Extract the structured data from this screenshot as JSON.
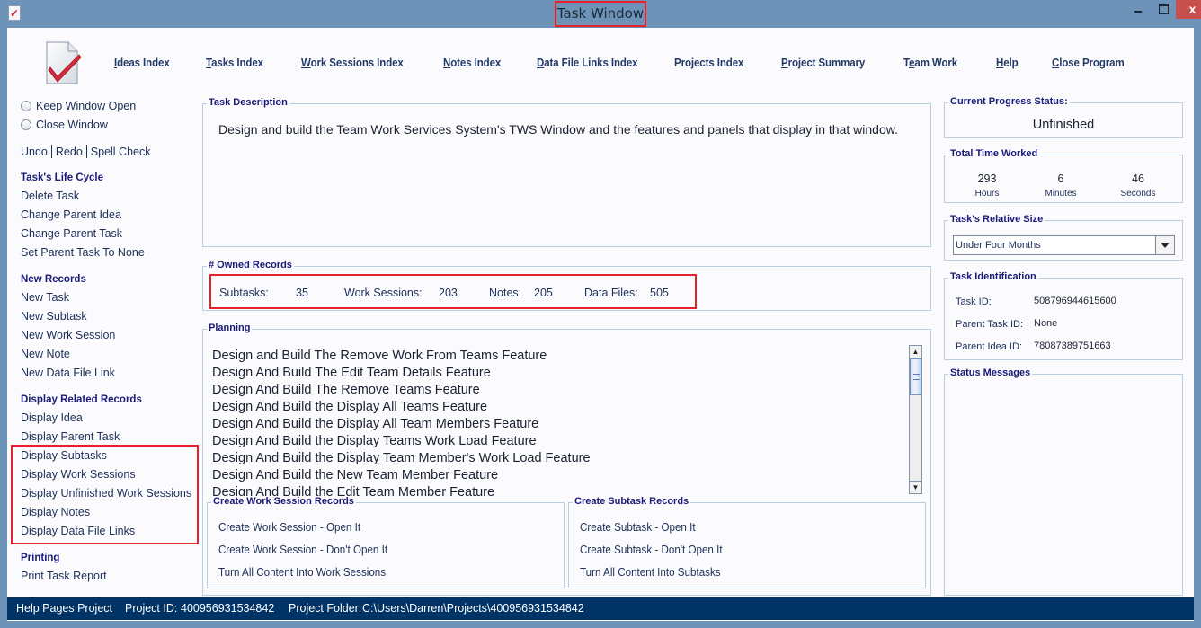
{
  "window": {
    "title": "Task Window",
    "close_glyph": "x"
  },
  "nav": [
    {
      "label": "Ideas Index",
      "mnemonic": "I"
    },
    {
      "label": "Tasks Index",
      "mnemonic": "T"
    },
    {
      "label": "Work Sessions Index",
      "mnemonic": "W"
    },
    {
      "label": "Notes Index",
      "mnemonic": "N"
    },
    {
      "label": "Data File Links Index",
      "mnemonic": "D"
    },
    {
      "label": "Projects Index",
      "mnemonic": ""
    },
    {
      "label": "Project Summary",
      "mnemonic": "P"
    },
    {
      "label": "Team Work",
      "mnemonic": "e"
    },
    {
      "label": "Help",
      "mnemonic": "H"
    },
    {
      "label": "Close Program",
      "mnemonic": "C"
    }
  ],
  "sidebar": {
    "radio_keep": "Keep Window Open",
    "radio_close": "Close Window",
    "undo": "Undo",
    "redo": "Redo",
    "spell_check": "Spell Check",
    "life_cycle": {
      "heading": "Task's Life Cycle",
      "items": [
        "Delete Task",
        "Change Parent Idea",
        "Change Parent Task",
        "Set Parent Task To None"
      ]
    },
    "new_records": {
      "heading": "New Records",
      "items": [
        "New Task",
        "New Subtask",
        "New Work Session",
        "New Note",
        "New Data File Link"
      ]
    },
    "display_related": {
      "heading": "Display Related Records",
      "items": [
        "Display Idea",
        "Display Parent Task",
        "Display Subtasks",
        "Display Work Sessions",
        "Display Unfinished Work Sessions",
        "Display Notes",
        "Display Data File Links"
      ]
    },
    "printing": {
      "heading": "Printing",
      "items": [
        "Print Task Report"
      ]
    }
  },
  "description": {
    "legend": "Task Description",
    "text": "Design and build the Team Work Services System's TWS Window and the features and panels that display in that window."
  },
  "owned_records": {
    "legend": "# Owned Records",
    "subtasks_label": "Subtasks:",
    "subtasks_value": "35",
    "work_sessions_label": "Work Sessions:",
    "work_sessions_value": "203",
    "notes_label": "Notes:",
    "notes_value": "205",
    "data_files_label": "Data Files:",
    "data_files_value": "505"
  },
  "planning": {
    "legend": "Planning",
    "items": [
      "Design and Build The Remove Work From Teams Feature",
      "Design And Build The Edit Team Details Feature",
      "Design And Build The Remove Teams Feature",
      "Design And Build the Display All Teams Feature",
      "Design And Build the Display All Team Members Feature",
      "Design And Build the Display Teams Work Load Feature",
      "Design And Build the Display Team Member's Work Load Feature",
      "Design And Build the New Team Member Feature",
      "Design And Build the Edit Team Member Feature"
    ]
  },
  "create_work_sessions": {
    "legend": "Create Work Session Records",
    "items": [
      "Create Work Session - Open It",
      "Create Work Session - Don't Open It",
      "Turn All Content Into Work Sessions"
    ]
  },
  "create_subtasks": {
    "legend": "Create Subtask Records",
    "items": [
      "Create Subtask - Open It",
      "Create Subtask - Don't Open It",
      "Turn All Content Into Subtasks"
    ]
  },
  "progress": {
    "legend": "Current Progress Status:",
    "value": "Unfinished"
  },
  "time_worked": {
    "legend": "Total Time Worked",
    "hours": "293",
    "hours_label": "Hours",
    "minutes": "6",
    "minutes_label": "Minutes",
    "seconds": "46",
    "seconds_label": "Seconds"
  },
  "relative_size": {
    "legend": "Task's Relative Size",
    "selected": "Under Four Months"
  },
  "identification": {
    "legend": "Task Identification",
    "task_id_label": "Task ID:",
    "task_id": "508796944615600",
    "parent_task_label": "Parent Task ID:",
    "parent_task_id": "None",
    "parent_idea_label": "Parent Idea ID:",
    "parent_idea_id": "78087389751663"
  },
  "status_messages": {
    "legend": "Status Messages"
  },
  "statusbar": {
    "project_name": "Help Pages Project",
    "project_id_label": "Project ID:",
    "project_id": "400956931534842",
    "project_folder_label": "Project Folder:",
    "project_folder": "C:\\Users\\Darren\\Projects\\400956931534842"
  },
  "colors": {
    "frame": "#6d93b8",
    "heading": "#1a1a78",
    "link": "#1c2f57",
    "statusbar": "#003366",
    "highlight": "#e8202a",
    "close_button": "#c7504d"
  }
}
